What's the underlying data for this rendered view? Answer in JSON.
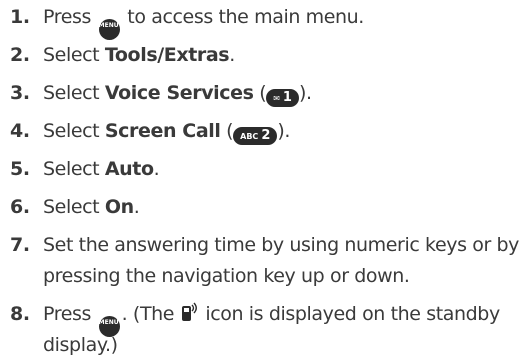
{
  "steps": [
    {
      "num": "1.",
      "before": "Press ",
      "key": "MENU OK",
      "after": " to access the main menu."
    },
    {
      "num": "2.",
      "before": "Select ",
      "bold": "Tools/Extras",
      "after": "."
    },
    {
      "num": "3.",
      "before": "Select ",
      "bold": "Voice Services",
      "mid": " (",
      "key_label": "✉",
      "key_digit": "1",
      "after": ")."
    },
    {
      "num": "4.",
      "before": "Select ",
      "bold": "Screen Call",
      "mid": " (",
      "key_label": "ABC",
      "key_digit": "2",
      "after": ")."
    },
    {
      "num": "5.",
      "before": "Select ",
      "bold": "Auto",
      "after": "."
    },
    {
      "num": "6.",
      "before": "Select ",
      "bold": "On",
      "after": "."
    },
    {
      "num": "7.",
      "line1": "Set the answering time by using numeric keys or by",
      "line2": "pressing the navigation key up or down."
    },
    {
      "num": "8.",
      "before": "Press ",
      "key": "MENU OK",
      "mid": ". (The ",
      "icon": "screen-call-phone-icon",
      "after": " icon is displayed on the standby",
      "line2": "display.)"
    }
  ]
}
